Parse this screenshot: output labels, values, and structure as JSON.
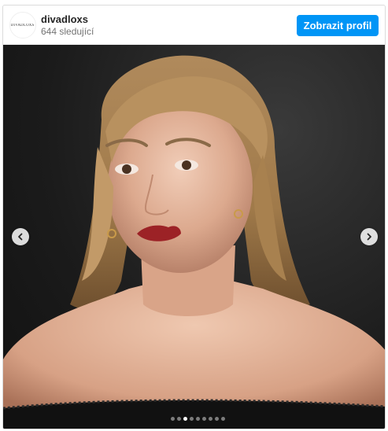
{
  "post": {
    "avatar_text": "DIVADLOXS",
    "username": "divadloxs",
    "followers": "644 sledující",
    "profile_button": "Zobrazit profil"
  },
  "carousel": {
    "dot_count": 9,
    "active_index": 2,
    "icons": {
      "prev": "chevron-left-icon",
      "next": "chevron-right-icon"
    }
  },
  "colors": {
    "accent": "#0095f6",
    "username": "#262626",
    "secondary_text": "#737373",
    "border": "#dbdbdb"
  }
}
